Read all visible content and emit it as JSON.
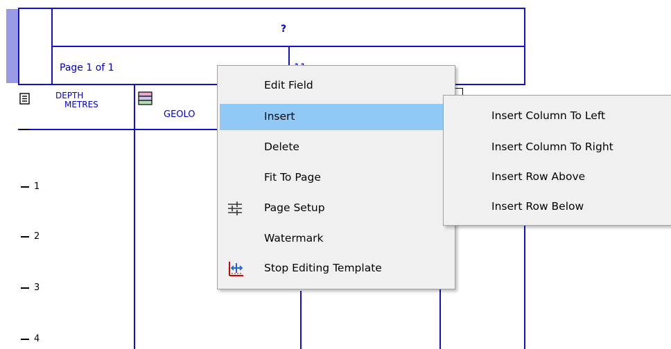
{
  "header": {
    "title": "?",
    "page_info": "Page 1 of 1",
    "date": "11-07-2017"
  },
  "columns": {
    "depth_label_top": "DEPTH",
    "depth_label_bottom": "METRES",
    "geology_label": "GEOLO"
  },
  "depth_ticks": [
    "1",
    "2",
    "3",
    "4"
  ],
  "context_menu": {
    "items": [
      {
        "label": "Edit Field"
      },
      {
        "label": "Insert",
        "has_submenu": true,
        "highlighted": true
      },
      {
        "label": "Delete",
        "has_submenu": true
      },
      {
        "label": "Fit To Page"
      },
      {
        "label": "Page Setup",
        "icon": "page-setup-icon"
      },
      {
        "label": "Watermark"
      },
      {
        "label": "Stop Editing Template",
        "icon": "stop-editing-template-icon"
      }
    ]
  },
  "submenu": {
    "items": [
      {
        "label": "Insert Column To Left"
      },
      {
        "label": "Insert Column To Right"
      },
      {
        "label": "Insert Row Above"
      },
      {
        "label": "Insert Row Below"
      }
    ]
  },
  "colors": {
    "grid": "#1010d0",
    "menu_bg": "#f0f0f0",
    "highlight": "#90c8f6",
    "selection_bar": "#9a9ae6"
  }
}
